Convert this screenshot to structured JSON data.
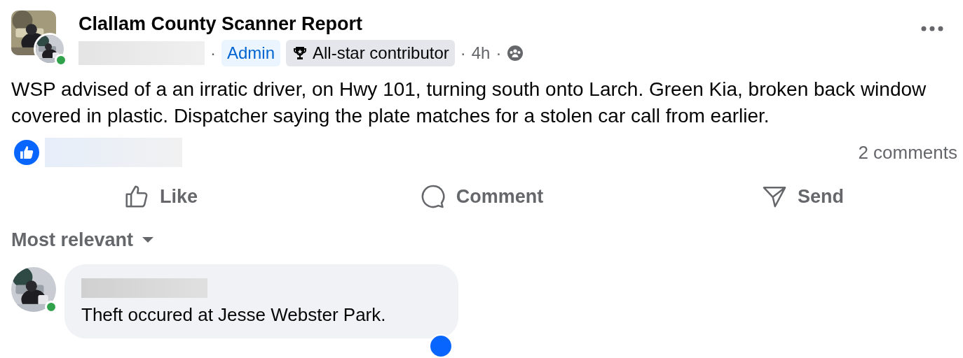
{
  "post": {
    "group": "Clallam County Scanner Report",
    "author_online": true,
    "badges": [
      {
        "kind": "role",
        "label": "Admin"
      },
      {
        "kind": "award",
        "label": "All-star contributor"
      }
    ],
    "separator": "·",
    "time": "4h",
    "text": "WSP advised of a an irratic driver, on Hwy 101, turning south onto Larch. Green Kia, broken back window covered in plastic. Dispatcher saying the plate matches for a stolen car call from earlier.",
    "comments_count": "2 comments"
  },
  "actions": [
    {
      "kind": "like",
      "label": "Like"
    },
    {
      "kind": "comment",
      "label": "Comment"
    },
    {
      "kind": "send",
      "label": "Send"
    }
  ],
  "sort": {
    "label": "Most relevant"
  },
  "comments": [
    {
      "online": true,
      "text": "Theft occured at Jesse Webster Park."
    }
  ]
}
